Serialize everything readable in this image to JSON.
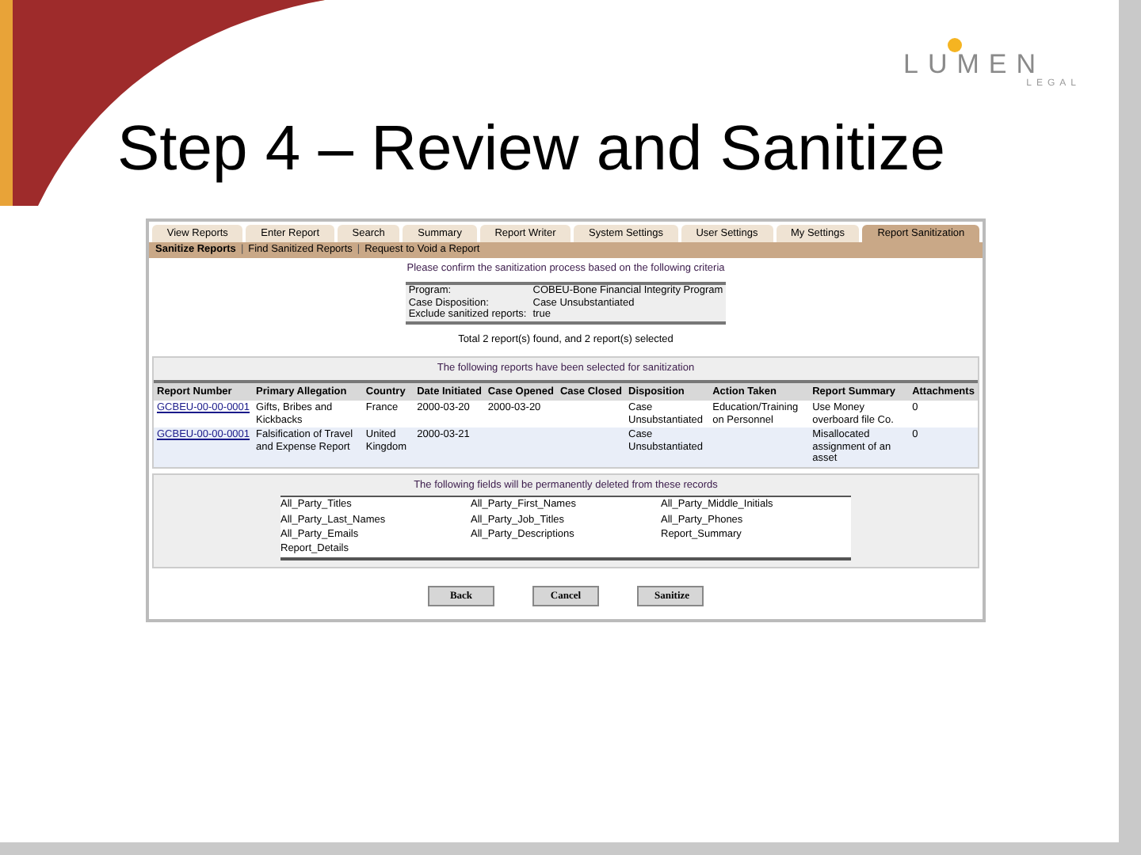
{
  "slide": {
    "title": "Step 4 – Review and Sanitize",
    "logo": {
      "name": "LUMEN",
      "subtitle": "LEGAL"
    }
  },
  "app": {
    "tabs": [
      {
        "label": "View Reports",
        "selected": false
      },
      {
        "label": "Enter Report",
        "selected": false
      },
      {
        "label": "Search",
        "selected": false
      },
      {
        "label": "Summary",
        "selected": false
      },
      {
        "label": "Report Writer",
        "selected": false
      },
      {
        "label": "System Settings",
        "selected": false
      },
      {
        "label": "User Settings",
        "selected": false
      },
      {
        "label": "My Settings",
        "selected": false
      },
      {
        "label": "Report Sanitization",
        "selected": true
      }
    ],
    "subnav_separator": "|",
    "subnav": [
      {
        "label": "Sanitize Reports",
        "selected": true
      },
      {
        "label": "Find Sanitized Reports",
        "selected": false
      },
      {
        "label": "Request to Void a Report",
        "selected": false
      }
    ],
    "confirm_text": "Please confirm the sanitization process based on the following criteria",
    "criteria": [
      {
        "label": "Program:",
        "value": "COBEU-Bone Financial Integrity Program"
      },
      {
        "label": "Case Disposition:",
        "value": "Case Unsubstantiated"
      },
      {
        "label": "Exclude sanitized reports:",
        "value": "true"
      }
    ],
    "total_text": "Total 2 report(s) found, and 2 report(s) selected",
    "table": {
      "caption": "The following reports have been selected for sanitization",
      "columns": [
        "Report Number",
        "Primary Allegation",
        "Country",
        "Date Initiated",
        "Case Opened",
        "Case Closed",
        "Disposition",
        "Action Taken",
        "Report Summary",
        "Attachments"
      ],
      "rows": [
        [
          "GCBEU-00-00-0001",
          "Gifts, Bribes and Kickbacks",
          "France",
          "2000-03-20",
          "2000-03-20",
          "",
          "Case Unsubstantiated",
          "Education/Training on Personnel",
          "Use Money overboard file Co.",
          "0"
        ],
        [
          "GCBEU-00-00-0001",
          "Falsification of Travel and Expense Report",
          "United Kingdom",
          "2000-03-21",
          "",
          "",
          "Case Unsubstantiated",
          "",
          "Misallocated assignment of an asset",
          "0"
        ]
      ]
    },
    "fields": {
      "caption": "The following fields will be permanently deleted from these records",
      "items": [
        "All_Party_Titles",
        "All_Party_First_Names",
        "All_Party_Middle_Initials",
        "All_Party_Last_Names",
        "All_Party_Job_Titles",
        "All_Party_Phones",
        "All_Party_Emails",
        "All_Party_Descriptions",
        "Report_Summary",
        "Report_Details"
      ]
    },
    "buttons": [
      "Back",
      "Cancel",
      "Sanitize"
    ]
  }
}
